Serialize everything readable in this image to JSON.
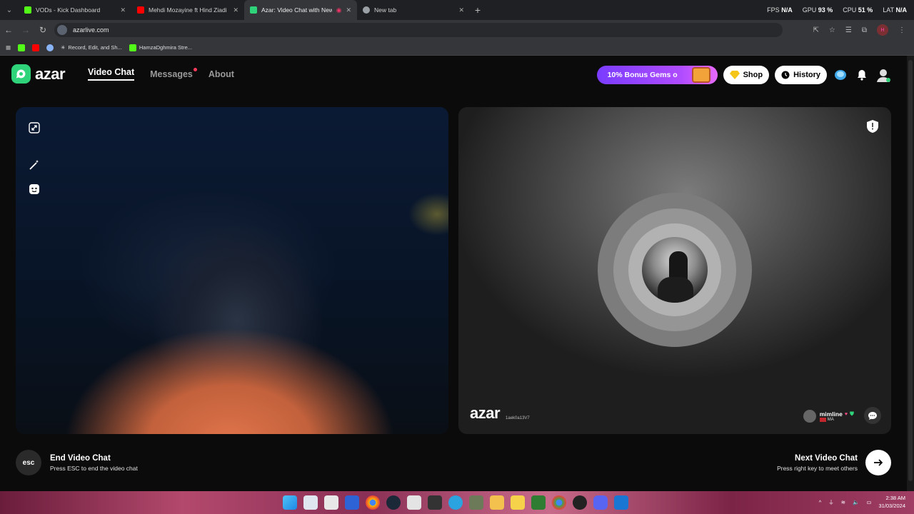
{
  "browser": {
    "tabs": [
      {
        "label": "VODs - Kick Dashboard",
        "color": "#53fc18"
      },
      {
        "label": "Mehdi Mozayine ft Hind Ziadi |",
        "color": "#ff0000"
      },
      {
        "label": "Azar: Video Chat with New",
        "color": "#2fd47a",
        "active": true
      },
      {
        "label": "New tab",
        "color": "#9aa0a6"
      }
    ],
    "url": "azarlive.com",
    "hud": {
      "fps_label": "FPS",
      "fps_value": "N/A",
      "gpu_label": "GPU",
      "gpu_value": "93 %",
      "cpu_label": "CPU",
      "cpu_value": "51 %",
      "lat_label": "LAT",
      "lat_value": "N/A"
    },
    "profile_initial": "H",
    "bookmarks": [
      {
        "label": "",
        "color": "#53fc18"
      },
      {
        "label": "",
        "color": "#ff0000"
      },
      {
        "label": "",
        "color": "#8ab4f8"
      },
      {
        "label": "Record, Edit, and Sh...",
        "color": "#ffffff"
      },
      {
        "label": "HamzaDghmira Stre...",
        "color": "#53fc18"
      }
    ]
  },
  "app": {
    "logo": "azar",
    "nav": {
      "video_chat": "Video Chat",
      "messages": "Messages",
      "about": "About"
    },
    "promo": "10% Bonus Gems o",
    "shop": "Shop",
    "history": "History",
    "accent": "#2fd47a",
    "remote": {
      "watermark": "azar",
      "session_id": "1aek0a13V7",
      "peer_name": "mimline",
      "peer_country": "MA"
    },
    "end": {
      "key": "esc",
      "title": "End Video Chat",
      "hint": "Press ESC to end the video chat"
    },
    "next": {
      "title": "Next Video Chat",
      "hint": "Press right key to meet others"
    }
  },
  "taskbar": {
    "time": "2:38 AM",
    "date": "31/03/2024"
  }
}
